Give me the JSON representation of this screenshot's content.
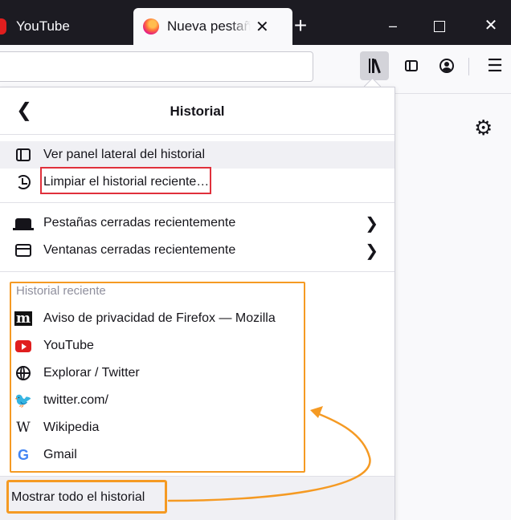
{
  "tabs": [
    {
      "title": "YouTube",
      "active": false
    },
    {
      "title": "Nueva pestaña",
      "active": true
    }
  ],
  "tab_close_glyph": "✕",
  "new_tab_glyph": "+",
  "window_controls": {
    "minimize": "–",
    "close": "✕"
  },
  "toolbar": {
    "url_value": "",
    "menu_glyph": "☰"
  },
  "page": {
    "settings_glyph": "⚙"
  },
  "panel": {
    "title": "Historial",
    "back_glyph": "❮",
    "actions": [
      {
        "label": "Ver panel lateral del historial",
        "icon": "sidebar-icon"
      },
      {
        "label": "Limpiar el historial reciente…",
        "icon": "history-icon"
      }
    ],
    "closed": [
      {
        "label": "Pestañas cerradas recientemente",
        "icon": "tabs-icon"
      },
      {
        "label": "Ventanas cerradas recientemente",
        "icon": "window-icon"
      }
    ],
    "chevron_glyph": "❯",
    "recent_label": "Historial reciente",
    "recent": [
      {
        "label": "Aviso de privacidad de Firefox — Mozilla",
        "icon": "mozilla-icon",
        "glyph": "m"
      },
      {
        "label": "YouTube",
        "icon": "youtube-icon"
      },
      {
        "label": "Explorar / Twitter",
        "icon": "globe-icon"
      },
      {
        "label": "twitter.com/",
        "icon": "twitter-icon",
        "glyph": "🐦"
      },
      {
        "label": "Wikipedia",
        "icon": "wikipedia-icon",
        "glyph": "W"
      },
      {
        "label": "Gmail",
        "icon": "google-icon",
        "glyph": "G"
      }
    ],
    "footer_label": "Mostrar todo el historial"
  },
  "colors": {
    "highlight_red": "#e0303b",
    "highlight_orange": "#f59a23",
    "tabstrip_bg": "#1c1b22"
  }
}
